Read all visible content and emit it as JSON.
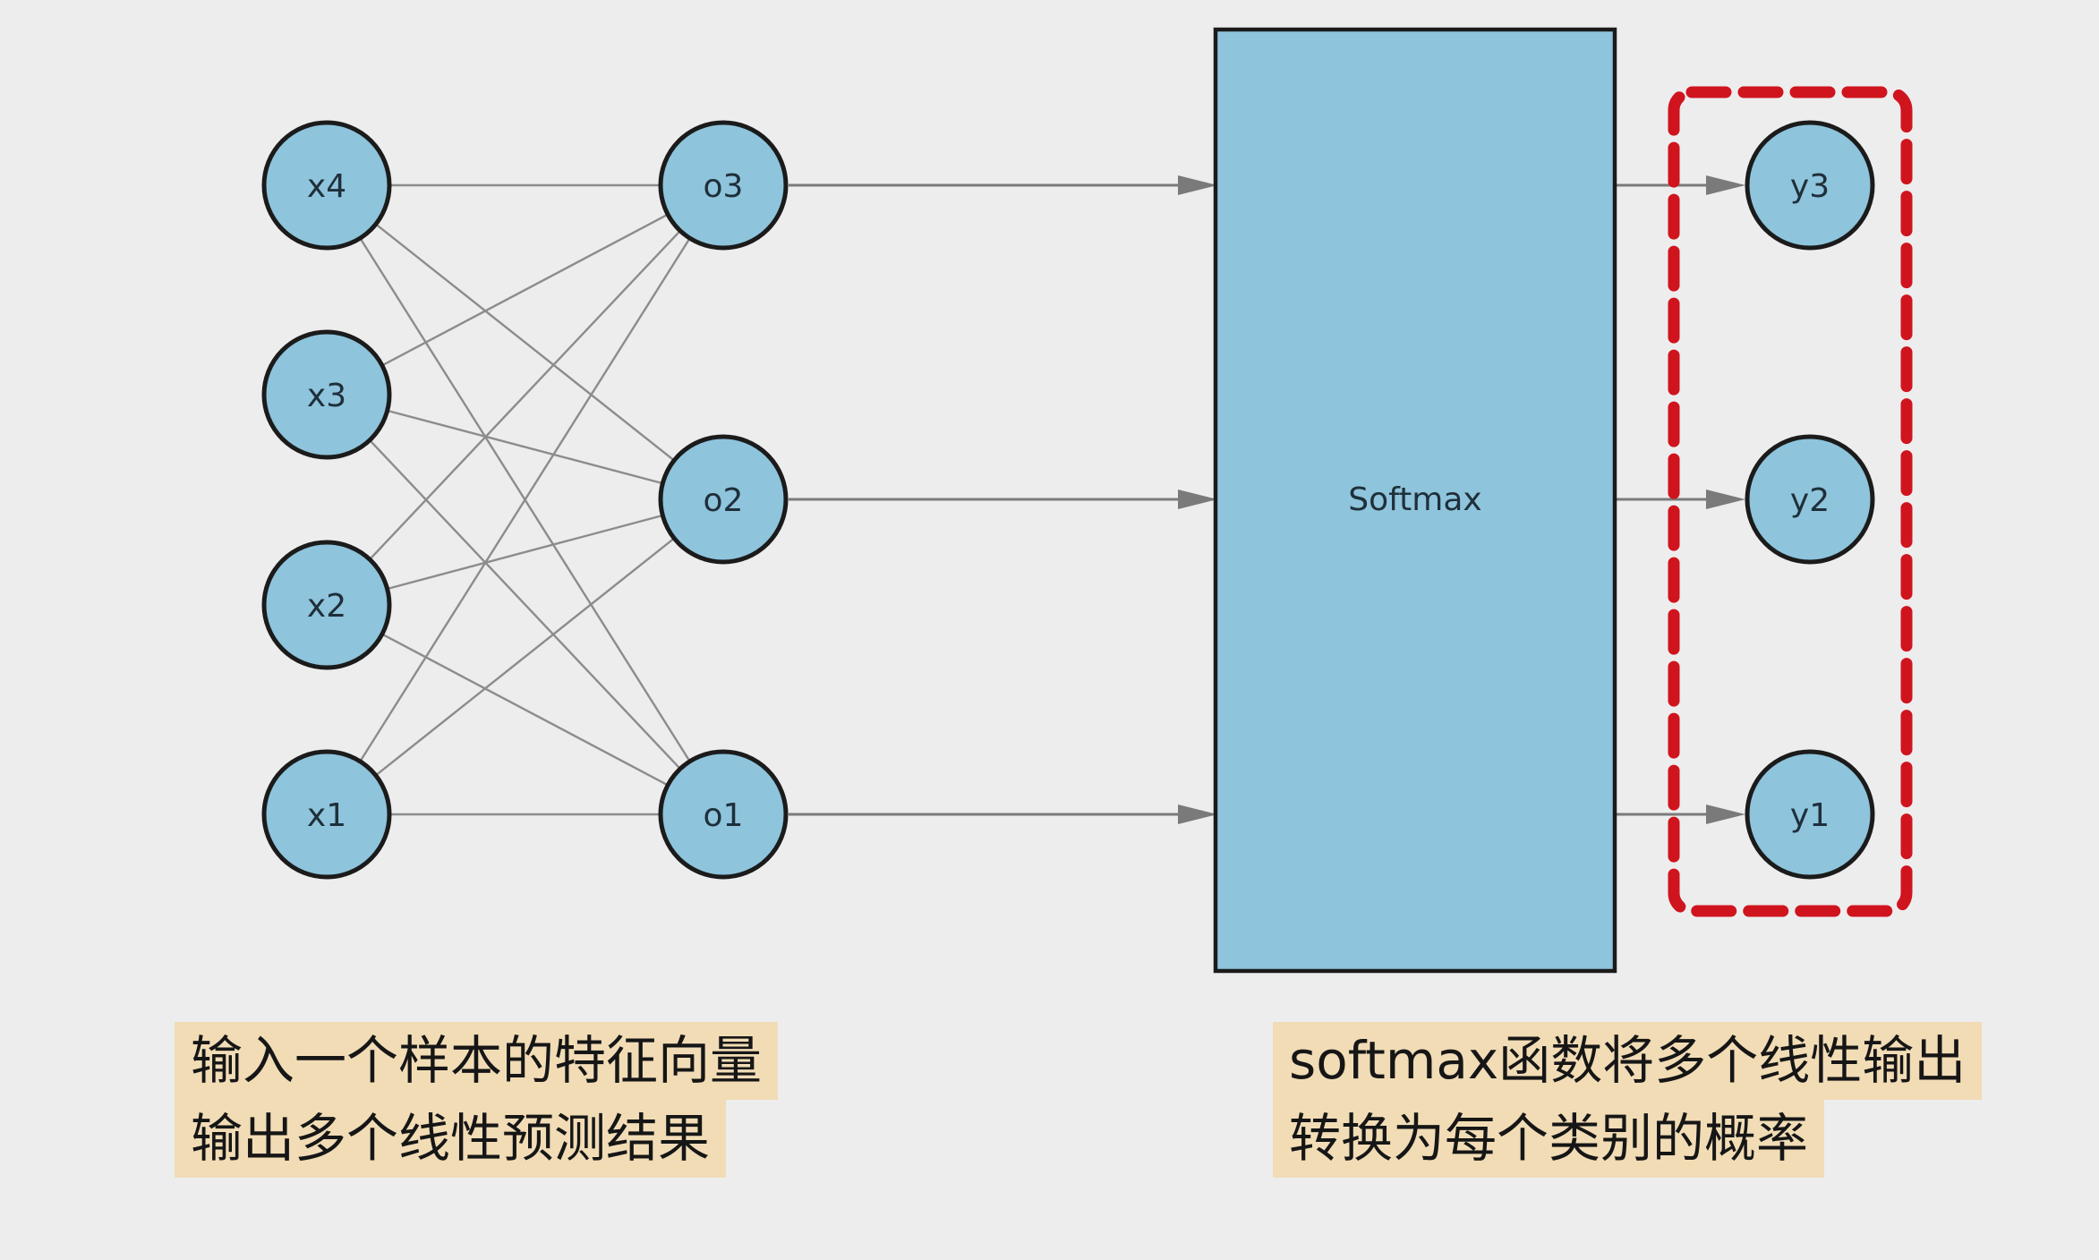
{
  "diagram": {
    "inputs": [
      "x4",
      "x3",
      "x2",
      "x1"
    ],
    "outputs": [
      "o3",
      "o2",
      "o1"
    ],
    "softmax_label": "Softmax",
    "probabilities": [
      "y3",
      "y2",
      "y1"
    ],
    "colors": {
      "node_fill": "#8ec4dc",
      "node_stroke": "#1b1b1b",
      "edge": "#8c8c8c",
      "arrow": "#7a7a7a",
      "highlight": "#d0141e",
      "caption_bg": "#f1dcb6",
      "background": "#ededed"
    }
  },
  "captions": {
    "left": {
      "line1": "输入一个样本的特征向量",
      "line2": "输出多个线性预测结果"
    },
    "right": {
      "line1": "softmax函数将多个线性输出",
      "line2": "转换为每个类别的概率"
    }
  }
}
